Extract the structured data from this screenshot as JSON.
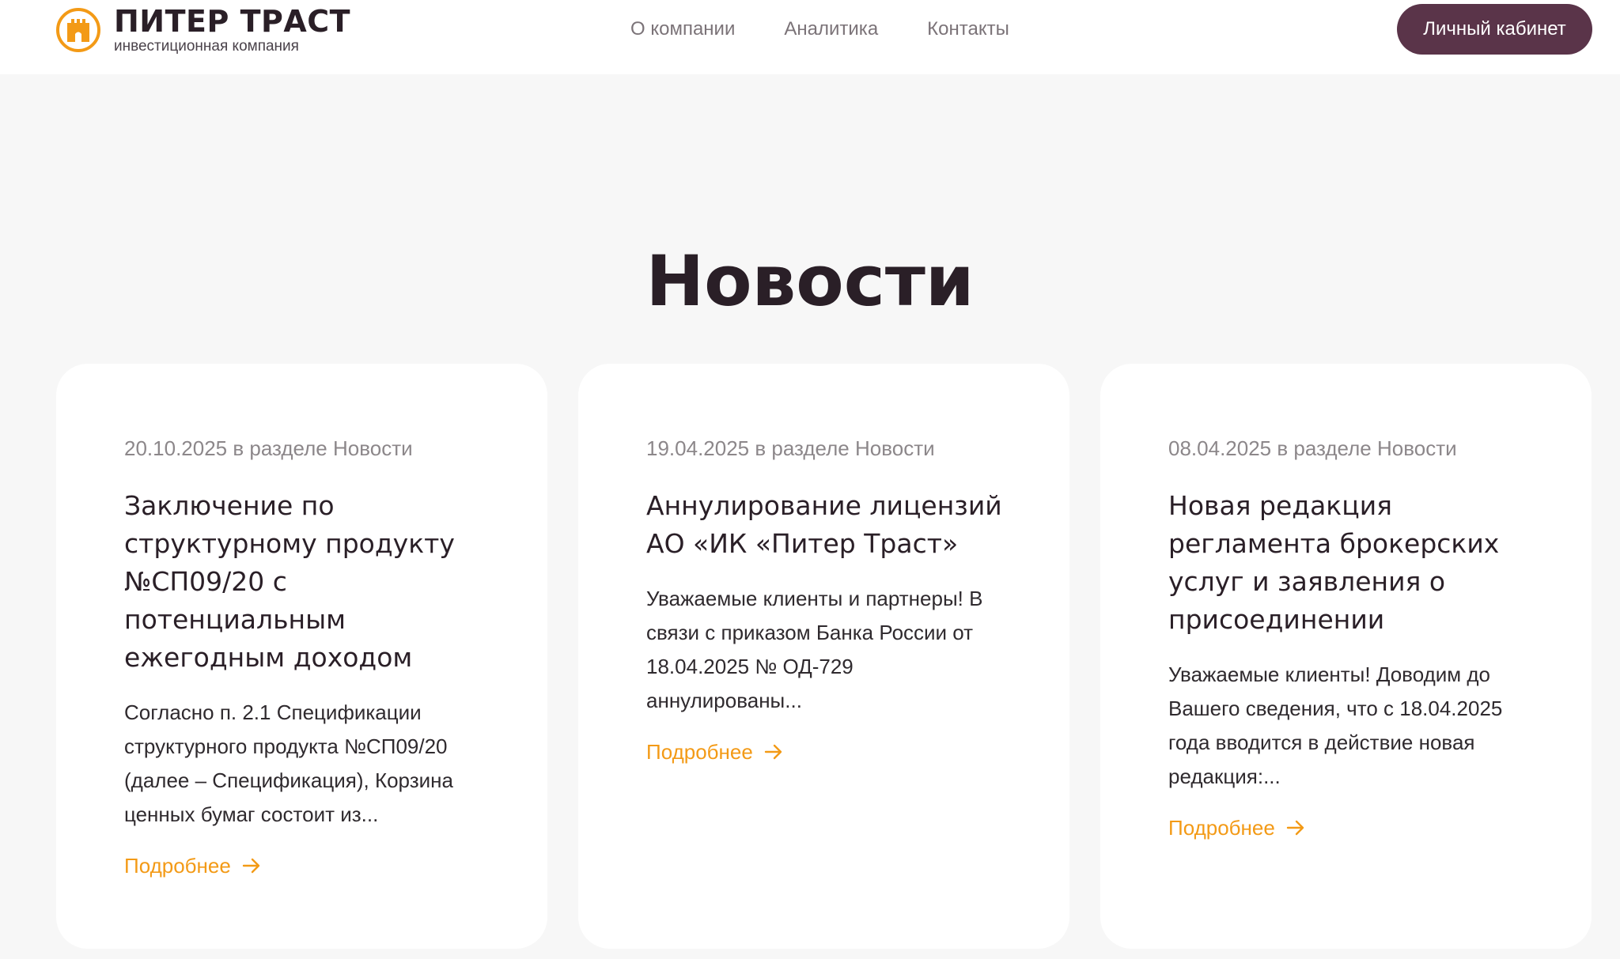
{
  "header": {
    "logo": {
      "title": "ПИТЕР ТРАСТ",
      "subtitle": "инвестиционная компания"
    },
    "nav": [
      {
        "label": "О компании"
      },
      {
        "label": "Аналитика"
      },
      {
        "label": "Контакты"
      }
    ],
    "cabinet_label": "Личный кабинет"
  },
  "news": {
    "title": "Новости",
    "cards": [
      {
        "meta": "20.10.2025 в разделе Новости",
        "title": "Заключение по структурному продукту №СП09/20 с потенциальным ежегодным доходом",
        "text": "Согласно п. 2.1 Спецификации структурного продукта №СП09/20 (далее – Спецификация), Корзина ценных бумаг состоит из...",
        "more": "Подробнее"
      },
      {
        "meta": "19.04.2025 в разделе Новости",
        "title": "Аннулирование лицензий АО «ИК «Питер Траст»",
        "text": "Уважаемые клиенты и партнеры! В связи с приказом Банка России от 18.04.2025 № ОД-729 аннулированы...",
        "more": "Подробнее"
      },
      {
        "meta": "08.04.2025 в разделе Новости",
        "title": "Новая редакция регламента брокерских услуг и заявления о присоединении",
        "text": "Уважаемые клиенты! Доводим до Вашего сведения, что с 18.04.2025 года вводится в действие новая редакция:...",
        "more": "Подробнее"
      }
    ]
  },
  "colors": {
    "accent": "#f39a16",
    "brand": "#5a3449",
    "background": "#f7f7f7",
    "text": "#2a1f27"
  },
  "icons": {
    "logo": "tower-logo-icon",
    "more": "arrow-right-icon"
  }
}
